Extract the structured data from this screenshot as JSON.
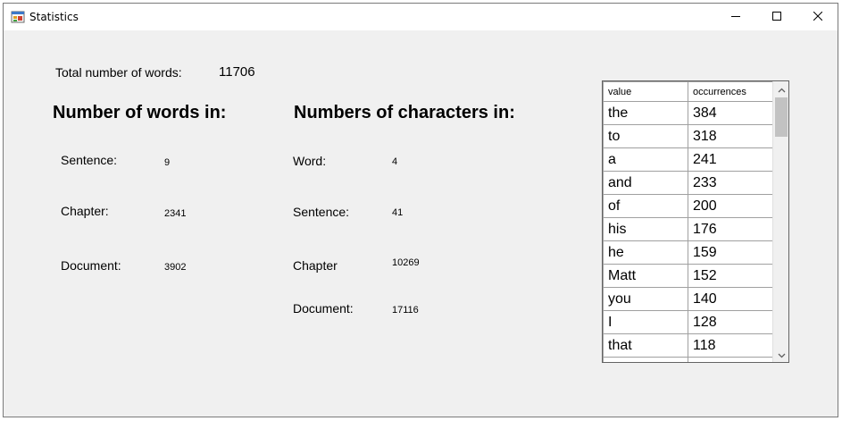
{
  "window": {
    "title": "Statistics",
    "icon": "app-form-icon",
    "controls": {
      "minimize": "minimize-icon",
      "maximize": "maximize-icon",
      "close": "close-icon"
    }
  },
  "total": {
    "label": "Total number of words:",
    "value": "11706"
  },
  "words_in": {
    "heading": "Number of words in:",
    "sentence_label": "Sentence:",
    "sentence_value": "9",
    "chapter_label": "Chapter:",
    "chapter_value": "2341",
    "document_label": "Document:",
    "document_value": "3902"
  },
  "chars_in": {
    "heading": "Numbers of characters in:",
    "word_label": "Word:",
    "word_value": "4",
    "sentence_label": "Sentence:",
    "sentence_value": "41",
    "chapter_label": "Chapter",
    "chapter_value": "10269",
    "document_label": "Document:",
    "document_value": "17116"
  },
  "grid": {
    "columns": [
      "value",
      "occurrences"
    ],
    "rows": [
      [
        "the",
        "384"
      ],
      [
        "to",
        "318"
      ],
      [
        "a",
        "241"
      ],
      [
        "and",
        "233"
      ],
      [
        "of",
        "200"
      ],
      [
        "his",
        "176"
      ],
      [
        "he",
        "159"
      ],
      [
        "Matt",
        "152"
      ],
      [
        "you",
        "140"
      ],
      [
        "I",
        "128"
      ],
      [
        "that",
        "118"
      ],
      [
        "",
        ""
      ]
    ]
  },
  "colors": {
    "window_bg": "#f0f0f0",
    "titlebar_bg": "#ffffff",
    "grid_border": "#646464"
  }
}
